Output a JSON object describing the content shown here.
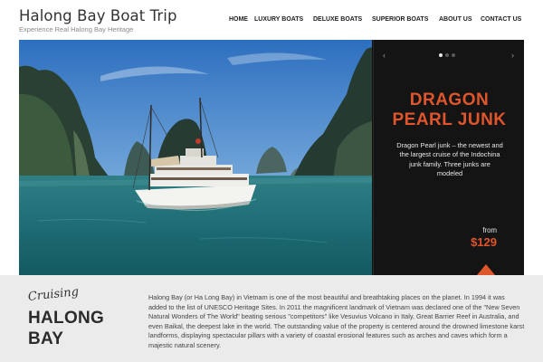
{
  "site": {
    "title": "Halong Bay Boat Trip",
    "tagline": "Experience Real Halong Bay Heritage"
  },
  "nav": {
    "items": [
      {
        "label": "HOME"
      },
      {
        "label": "LUXURY BOATS"
      },
      {
        "label": "DELUXE BOATS"
      },
      {
        "label": "SUPERIOR BOATS"
      },
      {
        "label": "ABOUT US"
      },
      {
        "label": "CONTACT US"
      }
    ]
  },
  "slider": {
    "prev_arrow": "‹",
    "next_arrow": "›",
    "slide_count": 3,
    "active_index": 0,
    "slide": {
      "title_line1": "DRAGON",
      "title_line2": "PEARL JUNK",
      "description": "Dragon Pearl junk – the newest and the largest cruise of the Indochina junk family. Three junks are modeled",
      "price_prefix": "from",
      "price": "$129"
    },
    "colors": {
      "accent": "#e0562c",
      "panel": "#141414"
    }
  },
  "intro": {
    "script_label": "Cruising",
    "heading_line1": "HALONG",
    "heading_line2": "BAY",
    "body": "Halong Bay (or Ha Long Bay) in Vietnam is one of the most beautiful and breathtaking places on the planet. In 1994 it was added to the list of UNESCO Heritage Sites. In 2011 the magnificent landmark of Vietnam was declared one of the \"New Seven Natural Wonders of The World\" beating serious \"competitors\" like Vesuvius Volcano in Italy, Great Barrier Reef in Australia, and even Baikal, the deepest lake in the world. The outstanding value of the property is centered around the drowned limestone karst landforms, displaying spectacular pillars with a variety of coastal erosional features such as arches and caves which form a majestic natural scenery."
  }
}
